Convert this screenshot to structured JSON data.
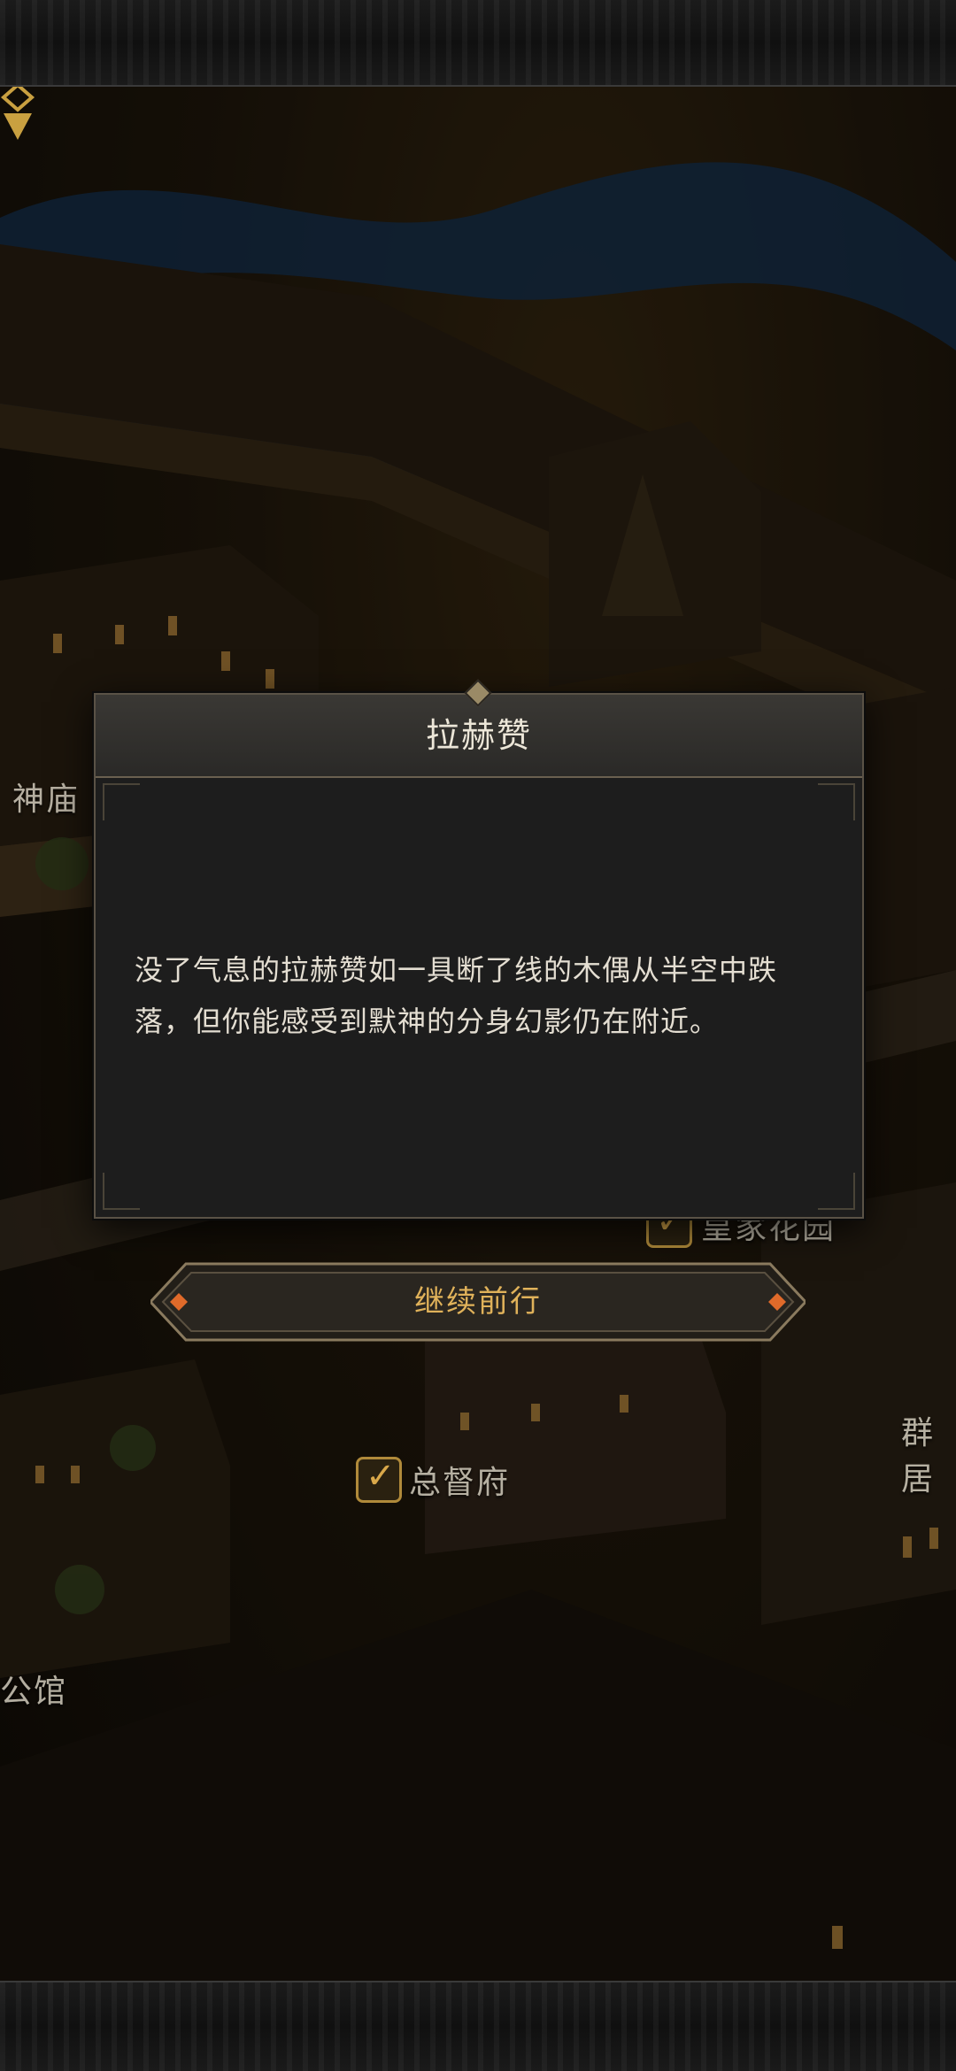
{
  "dialog": {
    "title": "拉赫赞",
    "body": "没了气息的拉赫赞如一具断了线的木偶从半空中跌落，但你能感受到默神的分身幻影仍在附近。"
  },
  "actions": {
    "continue_label": "继续前行"
  },
  "map": {
    "labels": {
      "temple": "神庙",
      "royal_garden": "皇家花园",
      "governor_office": "总督府",
      "mansion": "公馆",
      "partial_right": "群居"
    },
    "icons": {
      "checkmark": "checkmark-icon",
      "location_marker": "location-marker-icon"
    }
  },
  "colors": {
    "accent_gold": "#e0b25a",
    "dialog_bg": "#1d1d1d",
    "river": "#1a3f66"
  }
}
